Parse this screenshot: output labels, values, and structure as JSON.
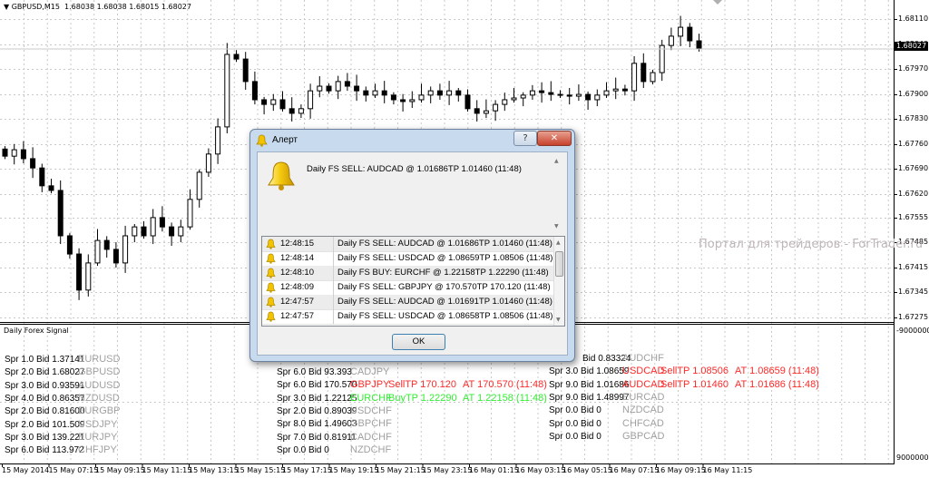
{
  "chart_header": {
    "symbol": "GBPUSD,M15",
    "ohlc": "1.68038 1.68038 1.68015 1.68027"
  },
  "colors": {
    "bull": "#ffffff",
    "bear": "#000000",
    "sell": "#ff2a2a",
    "buy": "#33ee33",
    "symbol_gray": "#a0a0a0"
  },
  "chart_data": {
    "type": "candlestick",
    "timeframe": "M15",
    "ylim": [
      1.67245,
      1.6813
    ],
    "price_ticks": [
      "1.68110",
      "1.68040",
      "1.67970",
      "1.67900",
      "1.67830",
      "1.67760",
      "1.67690",
      "1.67620",
      "1.67555",
      "1.67485",
      "1.67415",
      "1.67345",
      "1.67275"
    ],
    "price_tick_values": [
      1.6811,
      1.6804,
      1.6797,
      1.679,
      1.6783,
      1.6776,
      1.6769,
      1.6762,
      1.67555,
      1.67485,
      1.67415,
      1.67345,
      1.67275
    ],
    "current_price": "1.68027",
    "time_labels": [
      "15 May 2014",
      "15 May 07:15",
      "15 May 09:15",
      "15 May 11:15",
      "15 May 13:15",
      "15 May 15:15",
      "15 May 17:15",
      "15 May 19:15",
      "15 May 21:15",
      "15 May 23:15",
      "16 May 01:15",
      "16 May 03:15",
      "16 May 05:15",
      "16 May 07:15",
      "16 May 09:15",
      "16 May 11:15"
    ],
    "closes": [
      1.67726,
      1.67744,
      1.67719,
      1.67693,
      1.67643,
      1.6763,
      1.67503,
      1.67452,
      1.67351,
      1.67427,
      1.6749,
      1.67465,
      1.67427,
      1.67503,
      1.67528,
      1.67503,
      1.67554,
      1.67528,
      1.67503,
      1.67528,
      1.67605,
      1.67681,
      1.67732,
      1.67808,
      1.68011,
      1.67998,
      1.67935,
      1.67884,
      1.67871,
      1.67884,
      1.67859,
      1.67846,
      1.67859,
      1.67909,
      1.67922,
      1.67909,
      1.67935,
      1.67922,
      1.67909,
      1.67897,
      1.67909,
      1.67897,
      1.67884,
      1.67879,
      1.67884,
      1.67897,
      1.67909,
      1.67897,
      1.67909,
      1.67897,
      1.67859,
      1.67846,
      1.67853,
      1.67871,
      1.67884,
      1.67889,
      1.67897,
      1.67909,
      1.67904,
      1.67899,
      1.67897,
      1.67894,
      1.67899,
      1.67884,
      1.67897,
      1.67909,
      1.67914,
      1.67909,
      1.67986,
      1.67935,
      1.6796,
      1.68036,
      1.68062,
      1.68087,
      1.68049,
      1.68027
    ]
  },
  "indicator": {
    "title": "Daily Forex Signal",
    "scale_top": "-9000000",
    "scale_bottom": "9000000",
    "columns": [
      [
        {
          "info": "Spr 1.0 Bid 1.37141",
          "symbol": "EURUSD"
        },
        {
          "info": "Spr 2.0 Bid 1.68027",
          "symbol": "GBPUSD"
        },
        {
          "info": "Spr 3.0 Bid 0.93591",
          "symbol": "AUDUSD"
        },
        {
          "info": "Spr 4.0 Bid 0.86357",
          "symbol": "NZDUSD"
        },
        {
          "info": "Spr 2.0 Bid 0.81600",
          "symbol": "EURGBP"
        },
        {
          "info": "Spr 2.0 Bid 101.509",
          "symbol": "USDJPY"
        },
        {
          "info": "Spr 3.0 Bid 139.221",
          "symbol": "EURJPY"
        },
        {
          "info": "Spr 6.0 Bid 113.972",
          "symbol": "CHFJPY"
        }
      ],
      [
        {
          "info": "Spr 6.0 Bid 93.393",
          "symbol": "CADJPY"
        },
        {
          "info": "Spr 6.0 Bid 170.570",
          "symbol": "GBPJPY",
          "signal": "SellTP 170.120",
          "at": "AT 170.570 (11:48)",
          "kind": "sell"
        },
        {
          "info": "Spr 3.0 Bid 1.22125",
          "symbol": "EURCHF",
          "signal": "BuyTP 1.22290",
          "at": "AT 1.22158 (11:48)",
          "kind": "buy"
        },
        {
          "info": "Spr 2.0 Bid 0.89039",
          "symbol": "USDCHF"
        },
        {
          "info": "Spr 8.0 Bid 1.49603",
          "symbol": "GBPCHF"
        },
        {
          "info": "Spr 7.0 Bid 0.81911",
          "symbol": "CADCHF"
        },
        {
          "info": "Spr 0.0 Bid 0",
          "symbol": "NZDCHF"
        }
      ],
      [
        {
          "info": "Bid 0.83324",
          "symbol": "AUDCHF"
        },
        {
          "info": "Spr 3.0 Bid 1.08659",
          "symbol": "USDCAD",
          "signal": "SellTP 1.08506",
          "at": "AT 1.08659 (11:48)",
          "kind": "sell"
        },
        {
          "info": "Spr 9.0 Bid 1.01686",
          "symbol": "AUDCAD",
          "signal": "SellTP 1.01460",
          "at": "AT 1.01686 (11:48)",
          "kind": "sell"
        },
        {
          "info": "Spr 9.0 Bid 1.48997",
          "symbol": "EURCAD"
        },
        {
          "info": "Spr 0.0 Bid 0",
          "symbol": "NZDCAD"
        },
        {
          "info": "Spr 0.0 Bid 0",
          "symbol": "CHFCAD"
        },
        {
          "info": "Spr 0.0 Bid 0",
          "symbol": "GBPCAD"
        }
      ]
    ]
  },
  "watermark": "Портал для трейдеров - ForTrader.ru",
  "dialog": {
    "title": "Алерт",
    "help_label": "?",
    "close_label": "✕",
    "message": "Daily FS SELL:  AUDCAD  @  1.01686TP 1.01460  (11:48)",
    "icon": "bell-icon",
    "alerts": [
      {
        "time": "12:48:15",
        "text": "Daily FS SELL:  AUDCAD  @  1.01686TP 1.01460  (11:48)"
      },
      {
        "time": "12:48:14",
        "text": "Daily FS SELL:  USDCAD  @  1.08659TP 1.08506  (11:48)"
      },
      {
        "time": "12:48:10",
        "text": "Daily FS BUY:  EURCHF  @  1.22158TP 1.22290  (11:48)"
      },
      {
        "time": "12:48:09",
        "text": "Daily FS SELL:  GBPJPY  @  170.570TP 170.120  (11:48)"
      },
      {
        "time": "12:47:57",
        "text": "Daily FS SELL:  AUDCAD  @  1.01691TP 1.01460  (11:48)"
      },
      {
        "time": "12:47:57",
        "text": "Daily FS SELL:  USDCAD  @  1.08658TP 1.08506  (11:48)"
      }
    ],
    "ok_label": "OK"
  }
}
